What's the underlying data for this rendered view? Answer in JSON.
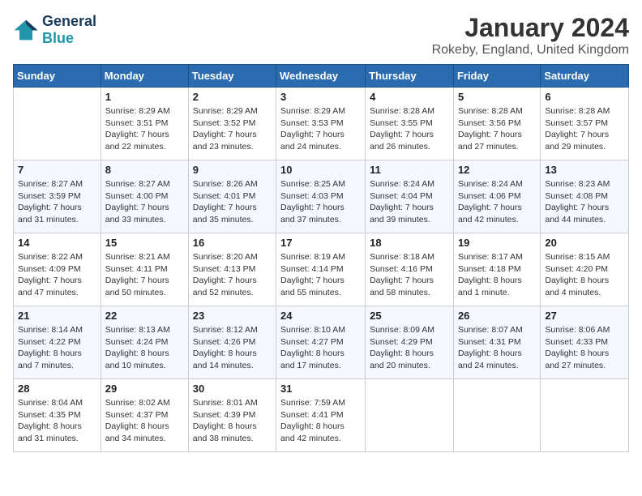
{
  "header": {
    "logo_line1": "General",
    "logo_line2": "Blue",
    "month_title": "January 2024",
    "location": "Rokeby, England, United Kingdom"
  },
  "days_of_week": [
    "Sunday",
    "Monday",
    "Tuesday",
    "Wednesday",
    "Thursday",
    "Friday",
    "Saturday"
  ],
  "weeks": [
    [
      {
        "day": "",
        "sunrise": "",
        "sunset": "",
        "daylight": ""
      },
      {
        "day": "1",
        "sunrise": "Sunrise: 8:29 AM",
        "sunset": "Sunset: 3:51 PM",
        "daylight": "Daylight: 7 hours and 22 minutes."
      },
      {
        "day": "2",
        "sunrise": "Sunrise: 8:29 AM",
        "sunset": "Sunset: 3:52 PM",
        "daylight": "Daylight: 7 hours and 23 minutes."
      },
      {
        "day": "3",
        "sunrise": "Sunrise: 8:29 AM",
        "sunset": "Sunset: 3:53 PM",
        "daylight": "Daylight: 7 hours and 24 minutes."
      },
      {
        "day": "4",
        "sunrise": "Sunrise: 8:28 AM",
        "sunset": "Sunset: 3:55 PM",
        "daylight": "Daylight: 7 hours and 26 minutes."
      },
      {
        "day": "5",
        "sunrise": "Sunrise: 8:28 AM",
        "sunset": "Sunset: 3:56 PM",
        "daylight": "Daylight: 7 hours and 27 minutes."
      },
      {
        "day": "6",
        "sunrise": "Sunrise: 8:28 AM",
        "sunset": "Sunset: 3:57 PM",
        "daylight": "Daylight: 7 hours and 29 minutes."
      }
    ],
    [
      {
        "day": "7",
        "sunrise": "Sunrise: 8:27 AM",
        "sunset": "Sunset: 3:59 PM",
        "daylight": "Daylight: 7 hours and 31 minutes."
      },
      {
        "day": "8",
        "sunrise": "Sunrise: 8:27 AM",
        "sunset": "Sunset: 4:00 PM",
        "daylight": "Daylight: 7 hours and 33 minutes."
      },
      {
        "day": "9",
        "sunrise": "Sunrise: 8:26 AM",
        "sunset": "Sunset: 4:01 PM",
        "daylight": "Daylight: 7 hours and 35 minutes."
      },
      {
        "day": "10",
        "sunrise": "Sunrise: 8:25 AM",
        "sunset": "Sunset: 4:03 PM",
        "daylight": "Daylight: 7 hours and 37 minutes."
      },
      {
        "day": "11",
        "sunrise": "Sunrise: 8:24 AM",
        "sunset": "Sunset: 4:04 PM",
        "daylight": "Daylight: 7 hours and 39 minutes."
      },
      {
        "day": "12",
        "sunrise": "Sunrise: 8:24 AM",
        "sunset": "Sunset: 4:06 PM",
        "daylight": "Daylight: 7 hours and 42 minutes."
      },
      {
        "day": "13",
        "sunrise": "Sunrise: 8:23 AM",
        "sunset": "Sunset: 4:08 PM",
        "daylight": "Daylight: 7 hours and 44 minutes."
      }
    ],
    [
      {
        "day": "14",
        "sunrise": "Sunrise: 8:22 AM",
        "sunset": "Sunset: 4:09 PM",
        "daylight": "Daylight: 7 hours and 47 minutes."
      },
      {
        "day": "15",
        "sunrise": "Sunrise: 8:21 AM",
        "sunset": "Sunset: 4:11 PM",
        "daylight": "Daylight: 7 hours and 50 minutes."
      },
      {
        "day": "16",
        "sunrise": "Sunrise: 8:20 AM",
        "sunset": "Sunset: 4:13 PM",
        "daylight": "Daylight: 7 hours and 52 minutes."
      },
      {
        "day": "17",
        "sunrise": "Sunrise: 8:19 AM",
        "sunset": "Sunset: 4:14 PM",
        "daylight": "Daylight: 7 hours and 55 minutes."
      },
      {
        "day": "18",
        "sunrise": "Sunrise: 8:18 AM",
        "sunset": "Sunset: 4:16 PM",
        "daylight": "Daylight: 7 hours and 58 minutes."
      },
      {
        "day": "19",
        "sunrise": "Sunrise: 8:17 AM",
        "sunset": "Sunset: 4:18 PM",
        "daylight": "Daylight: 8 hours and 1 minute."
      },
      {
        "day": "20",
        "sunrise": "Sunrise: 8:15 AM",
        "sunset": "Sunset: 4:20 PM",
        "daylight": "Daylight: 8 hours and 4 minutes."
      }
    ],
    [
      {
        "day": "21",
        "sunrise": "Sunrise: 8:14 AM",
        "sunset": "Sunset: 4:22 PM",
        "daylight": "Daylight: 8 hours and 7 minutes."
      },
      {
        "day": "22",
        "sunrise": "Sunrise: 8:13 AM",
        "sunset": "Sunset: 4:24 PM",
        "daylight": "Daylight: 8 hours and 10 minutes."
      },
      {
        "day": "23",
        "sunrise": "Sunrise: 8:12 AM",
        "sunset": "Sunset: 4:26 PM",
        "daylight": "Daylight: 8 hours and 14 minutes."
      },
      {
        "day": "24",
        "sunrise": "Sunrise: 8:10 AM",
        "sunset": "Sunset: 4:27 PM",
        "daylight": "Daylight: 8 hours and 17 minutes."
      },
      {
        "day": "25",
        "sunrise": "Sunrise: 8:09 AM",
        "sunset": "Sunset: 4:29 PM",
        "daylight": "Daylight: 8 hours and 20 minutes."
      },
      {
        "day": "26",
        "sunrise": "Sunrise: 8:07 AM",
        "sunset": "Sunset: 4:31 PM",
        "daylight": "Daylight: 8 hours and 24 minutes."
      },
      {
        "day": "27",
        "sunrise": "Sunrise: 8:06 AM",
        "sunset": "Sunset: 4:33 PM",
        "daylight": "Daylight: 8 hours and 27 minutes."
      }
    ],
    [
      {
        "day": "28",
        "sunrise": "Sunrise: 8:04 AM",
        "sunset": "Sunset: 4:35 PM",
        "daylight": "Daylight: 8 hours and 31 minutes."
      },
      {
        "day": "29",
        "sunrise": "Sunrise: 8:02 AM",
        "sunset": "Sunset: 4:37 PM",
        "daylight": "Daylight: 8 hours and 34 minutes."
      },
      {
        "day": "30",
        "sunrise": "Sunrise: 8:01 AM",
        "sunset": "Sunset: 4:39 PM",
        "daylight": "Daylight: 8 hours and 38 minutes."
      },
      {
        "day": "31",
        "sunrise": "Sunrise: 7:59 AM",
        "sunset": "Sunset: 4:41 PM",
        "daylight": "Daylight: 8 hours and 42 minutes."
      },
      {
        "day": "",
        "sunrise": "",
        "sunset": "",
        "daylight": ""
      },
      {
        "day": "",
        "sunrise": "",
        "sunset": "",
        "daylight": ""
      },
      {
        "day": "",
        "sunrise": "",
        "sunset": "",
        "daylight": ""
      }
    ]
  ]
}
